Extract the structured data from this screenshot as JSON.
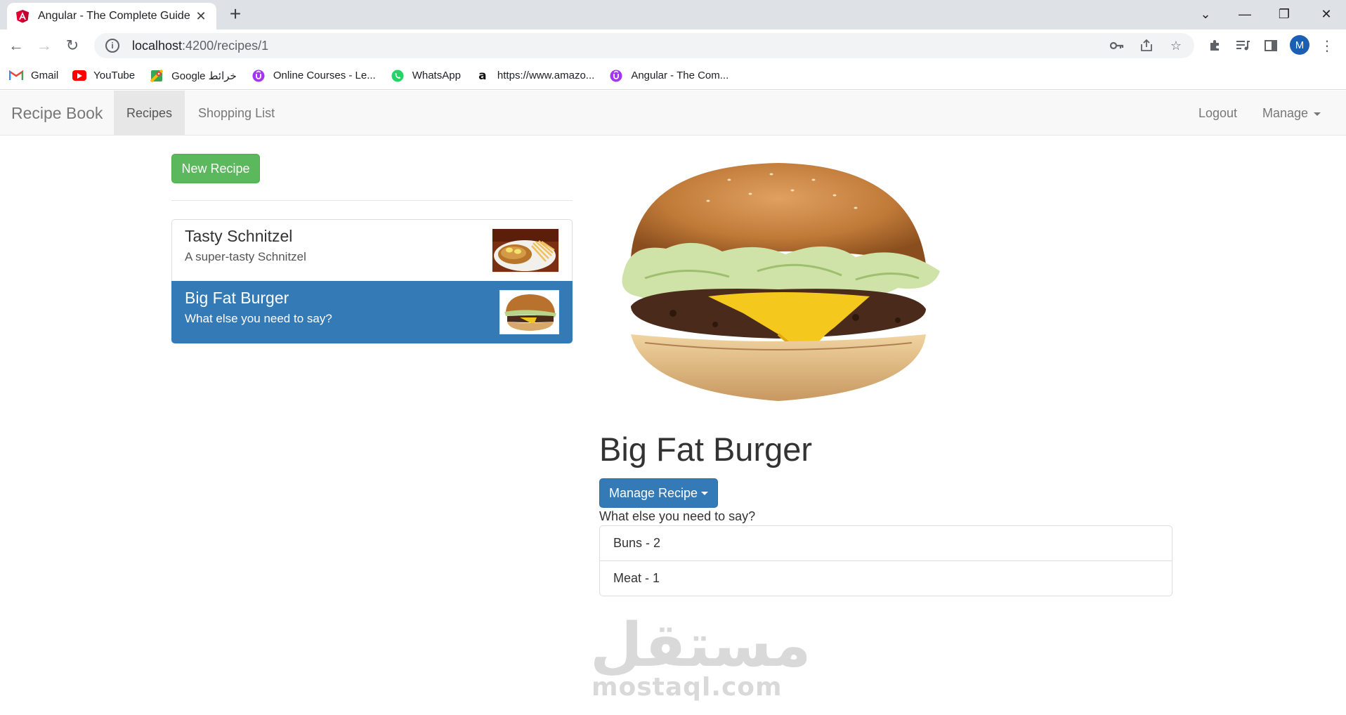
{
  "browser": {
    "tab_title": "Angular - The Complete Guide",
    "url_host": "localhost",
    "url_path": ":4200/recipes/1",
    "profile_initial": "M",
    "bookmarks": [
      {
        "label": "Gmail",
        "icon": "gmail-icon"
      },
      {
        "label": "YouTube",
        "icon": "youtube-icon"
      },
      {
        "label": "Google خرائط",
        "icon": "google-maps-icon"
      },
      {
        "label": "Online Courses - Le...",
        "icon": "udemy-icon"
      },
      {
        "label": "WhatsApp",
        "icon": "whatsapp-icon"
      },
      {
        "label": "https://www.amazo...",
        "icon": "amazon-icon"
      },
      {
        "label": "Angular - The Com...",
        "icon": "udemy-icon"
      }
    ]
  },
  "navbar": {
    "brand": "Recipe Book",
    "recipes": "Recipes",
    "shopping_list": "Shopping List",
    "logout": "Logout",
    "manage": "Manage"
  },
  "sidebar": {
    "new_recipe": "New Recipe",
    "recipes": [
      {
        "name": "Tasty Schnitzel",
        "description": "A super-tasty Schnitzel",
        "active": false
      },
      {
        "name": "Big Fat Burger",
        "description": "What else you need to say?",
        "active": true
      }
    ]
  },
  "detail": {
    "title": "Big Fat Burger",
    "manage_button": "Manage Recipe",
    "description": "What else you need to say?",
    "ingredients": [
      "Buns - 2",
      "Meat - 1"
    ]
  },
  "watermark": {
    "arabic": "مستقل",
    "latin": "mostaql.com"
  },
  "colors": {
    "success": "#5cb85c",
    "primary": "#337ab7"
  }
}
